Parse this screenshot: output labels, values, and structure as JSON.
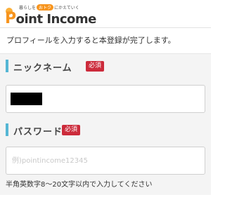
{
  "header": {
    "tagline_before": "暮らしを",
    "tagline_highlight": "おトク",
    "tagline_after": "にかえていく",
    "logo_p": "P",
    "logo_text": "oint Income"
  },
  "intro": "プロフィールを入力すると本登録が完了します。",
  "nickname": {
    "title": "ニックネーム",
    "required": "必須"
  },
  "password": {
    "title": "パスワード",
    "required": "必須",
    "placeholder": "例)pointincome12345",
    "hint": "半角英数字8〜20文字以内で入力してください"
  }
}
